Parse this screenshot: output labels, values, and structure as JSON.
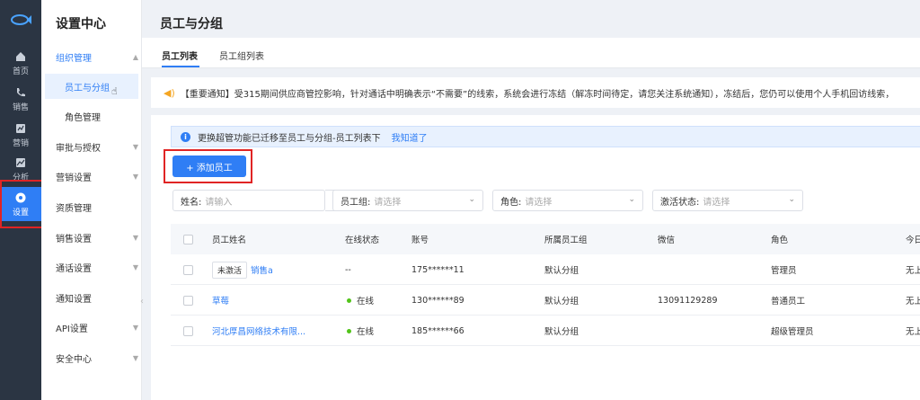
{
  "rail": {
    "items": [
      {
        "label": "首页",
        "icon": "home-icon"
      },
      {
        "label": "销售",
        "icon": "phone-icon"
      },
      {
        "label": "营销",
        "icon": "marketing-icon"
      },
      {
        "label": "分析",
        "icon": "chart-icon"
      },
      {
        "label": "设置",
        "icon": "settings-icon",
        "active": true
      }
    ]
  },
  "submenu": {
    "title": "设置中心",
    "groups": [
      {
        "label": "组织管理",
        "open": true
      },
      {
        "label": "员工与分组",
        "active": true
      },
      {
        "label": "角色管理"
      },
      {
        "label": "审批与授权"
      },
      {
        "label": "营销设置"
      },
      {
        "label": "资质管理"
      },
      {
        "label": "销售设置"
      },
      {
        "label": "通话设置"
      },
      {
        "label": "通知设置"
      },
      {
        "label": "API设置"
      },
      {
        "label": "安全中心"
      }
    ]
  },
  "page": {
    "title": "员工与分组",
    "tabs": [
      "员工列表",
      "员工组列表"
    ]
  },
  "notice": "【重要通知】受315期间供应商管控影响，针对通话中明确表示“不需要”的线索，系统会进行冻结（解冻时间待定，请您关注系统通知），冻结后，您仍可以使用个人手机回访线索，",
  "info": {
    "text": "更换超管功能已迁移至员工与分组-员工列表下",
    "link": "我知道了"
  },
  "add_button": "+ 添加员工",
  "filters": {
    "name_label": "姓名:",
    "name_placeholder": "请输入",
    "group_label": "员工组:",
    "group_placeholder": "请选择",
    "role_label": "角色:",
    "role_placeholder": "请选择",
    "status_label": "激活状态:",
    "status_placeholder": "请选择"
  },
  "table": {
    "headers": [
      "员工姓名",
      "在线状态",
      "账号",
      "所属员工组",
      "微信",
      "角色",
      "今日"
    ],
    "rows": [
      {
        "tag": "未激活",
        "name": "销售a",
        "status": "--",
        "account": "175******11",
        "group": "默认分组",
        "wechat": "",
        "role": "管理员",
        "today": "无上"
      },
      {
        "tag": "",
        "name": "草莓",
        "status": "在线",
        "account": "130******89",
        "group": "默认分组",
        "wechat": "13091129289",
        "role": "普通员工",
        "today": "无上"
      },
      {
        "tag": "",
        "name": "河北厚昌网络技术有限...",
        "status": "在线",
        "account": "185******66",
        "group": "默认分组",
        "wechat": "",
        "role": "超级管理员",
        "today": "无上"
      }
    ]
  },
  "colors": {
    "accent": "#2f7ef5",
    "rail": "#2b3543",
    "online": "#52c41a",
    "highlight": "#e02424"
  }
}
